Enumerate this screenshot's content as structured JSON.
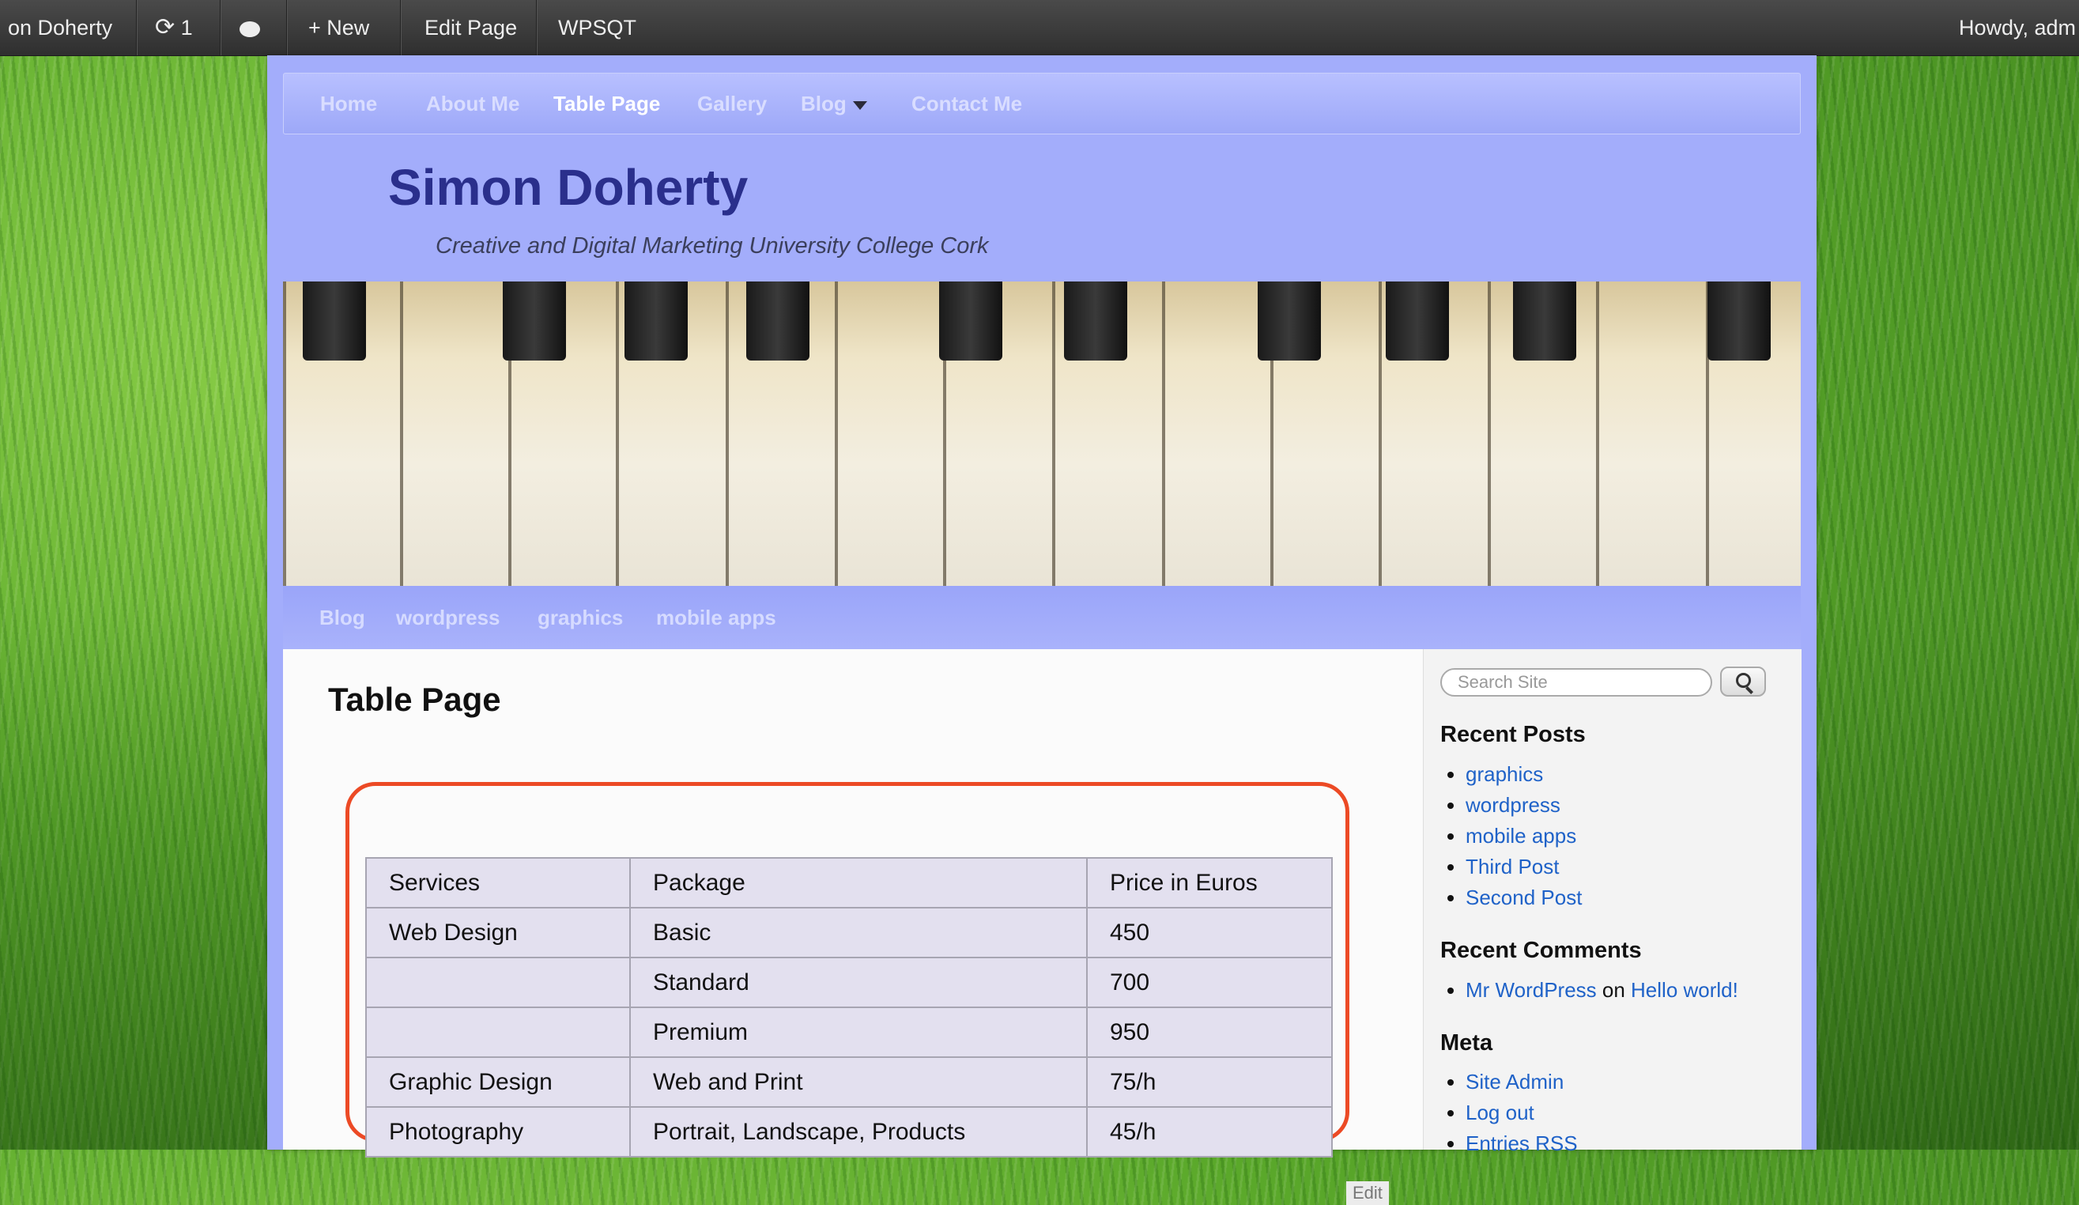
{
  "adminbar": {
    "user_partial": "on Doherty",
    "updates_count": "1",
    "new_label": "+ New",
    "edit_page_label": "Edit Page",
    "plugin_label": "WPSQT",
    "howdy_label": "Howdy, adm"
  },
  "topnav": {
    "items": [
      "Home",
      "About Me",
      "Table Page",
      "Gallery",
      "Blog",
      "Contact Me"
    ],
    "active": "Table Page"
  },
  "site": {
    "title": "Simon Doherty",
    "description": "Creative and Digital Marketing University College Cork"
  },
  "subnav": {
    "items": [
      "Blog",
      "wordpress",
      "graphics",
      "mobile apps"
    ]
  },
  "content": {
    "page_title": "Table Page",
    "table": {
      "rows": [
        [
          "Services",
          "Package",
          "Price in Euros"
        ],
        [
          "Web Design",
          "Basic",
          "450"
        ],
        [
          "",
          "Standard",
          "700"
        ],
        [
          "",
          "Premium",
          "950"
        ],
        [
          "Graphic Design",
          "Web and Print",
          "75/h"
        ],
        [
          "Photography",
          "Portrait, Landscape, Products",
          "45/h"
        ]
      ]
    },
    "edit_label": "Edit"
  },
  "sidebar": {
    "search_placeholder": "Search Site",
    "recent_posts_title": "Recent Posts",
    "recent_posts": [
      "graphics",
      "wordpress",
      "mobile apps",
      "Third Post",
      "Second Post"
    ],
    "recent_comments_title": "Recent Comments",
    "comment": {
      "author": "Mr WordPress",
      "on": " on ",
      "post": "Hello world!"
    },
    "meta_title": "Meta",
    "meta": [
      "Site Admin",
      "Log out",
      "Entries RSS"
    ]
  },
  "colors": {
    "accent_highlight": "#ec4a25",
    "page_bg": "#a3adfb",
    "title_color": "#2a2f8c",
    "link_color": "#1f62c8"
  }
}
